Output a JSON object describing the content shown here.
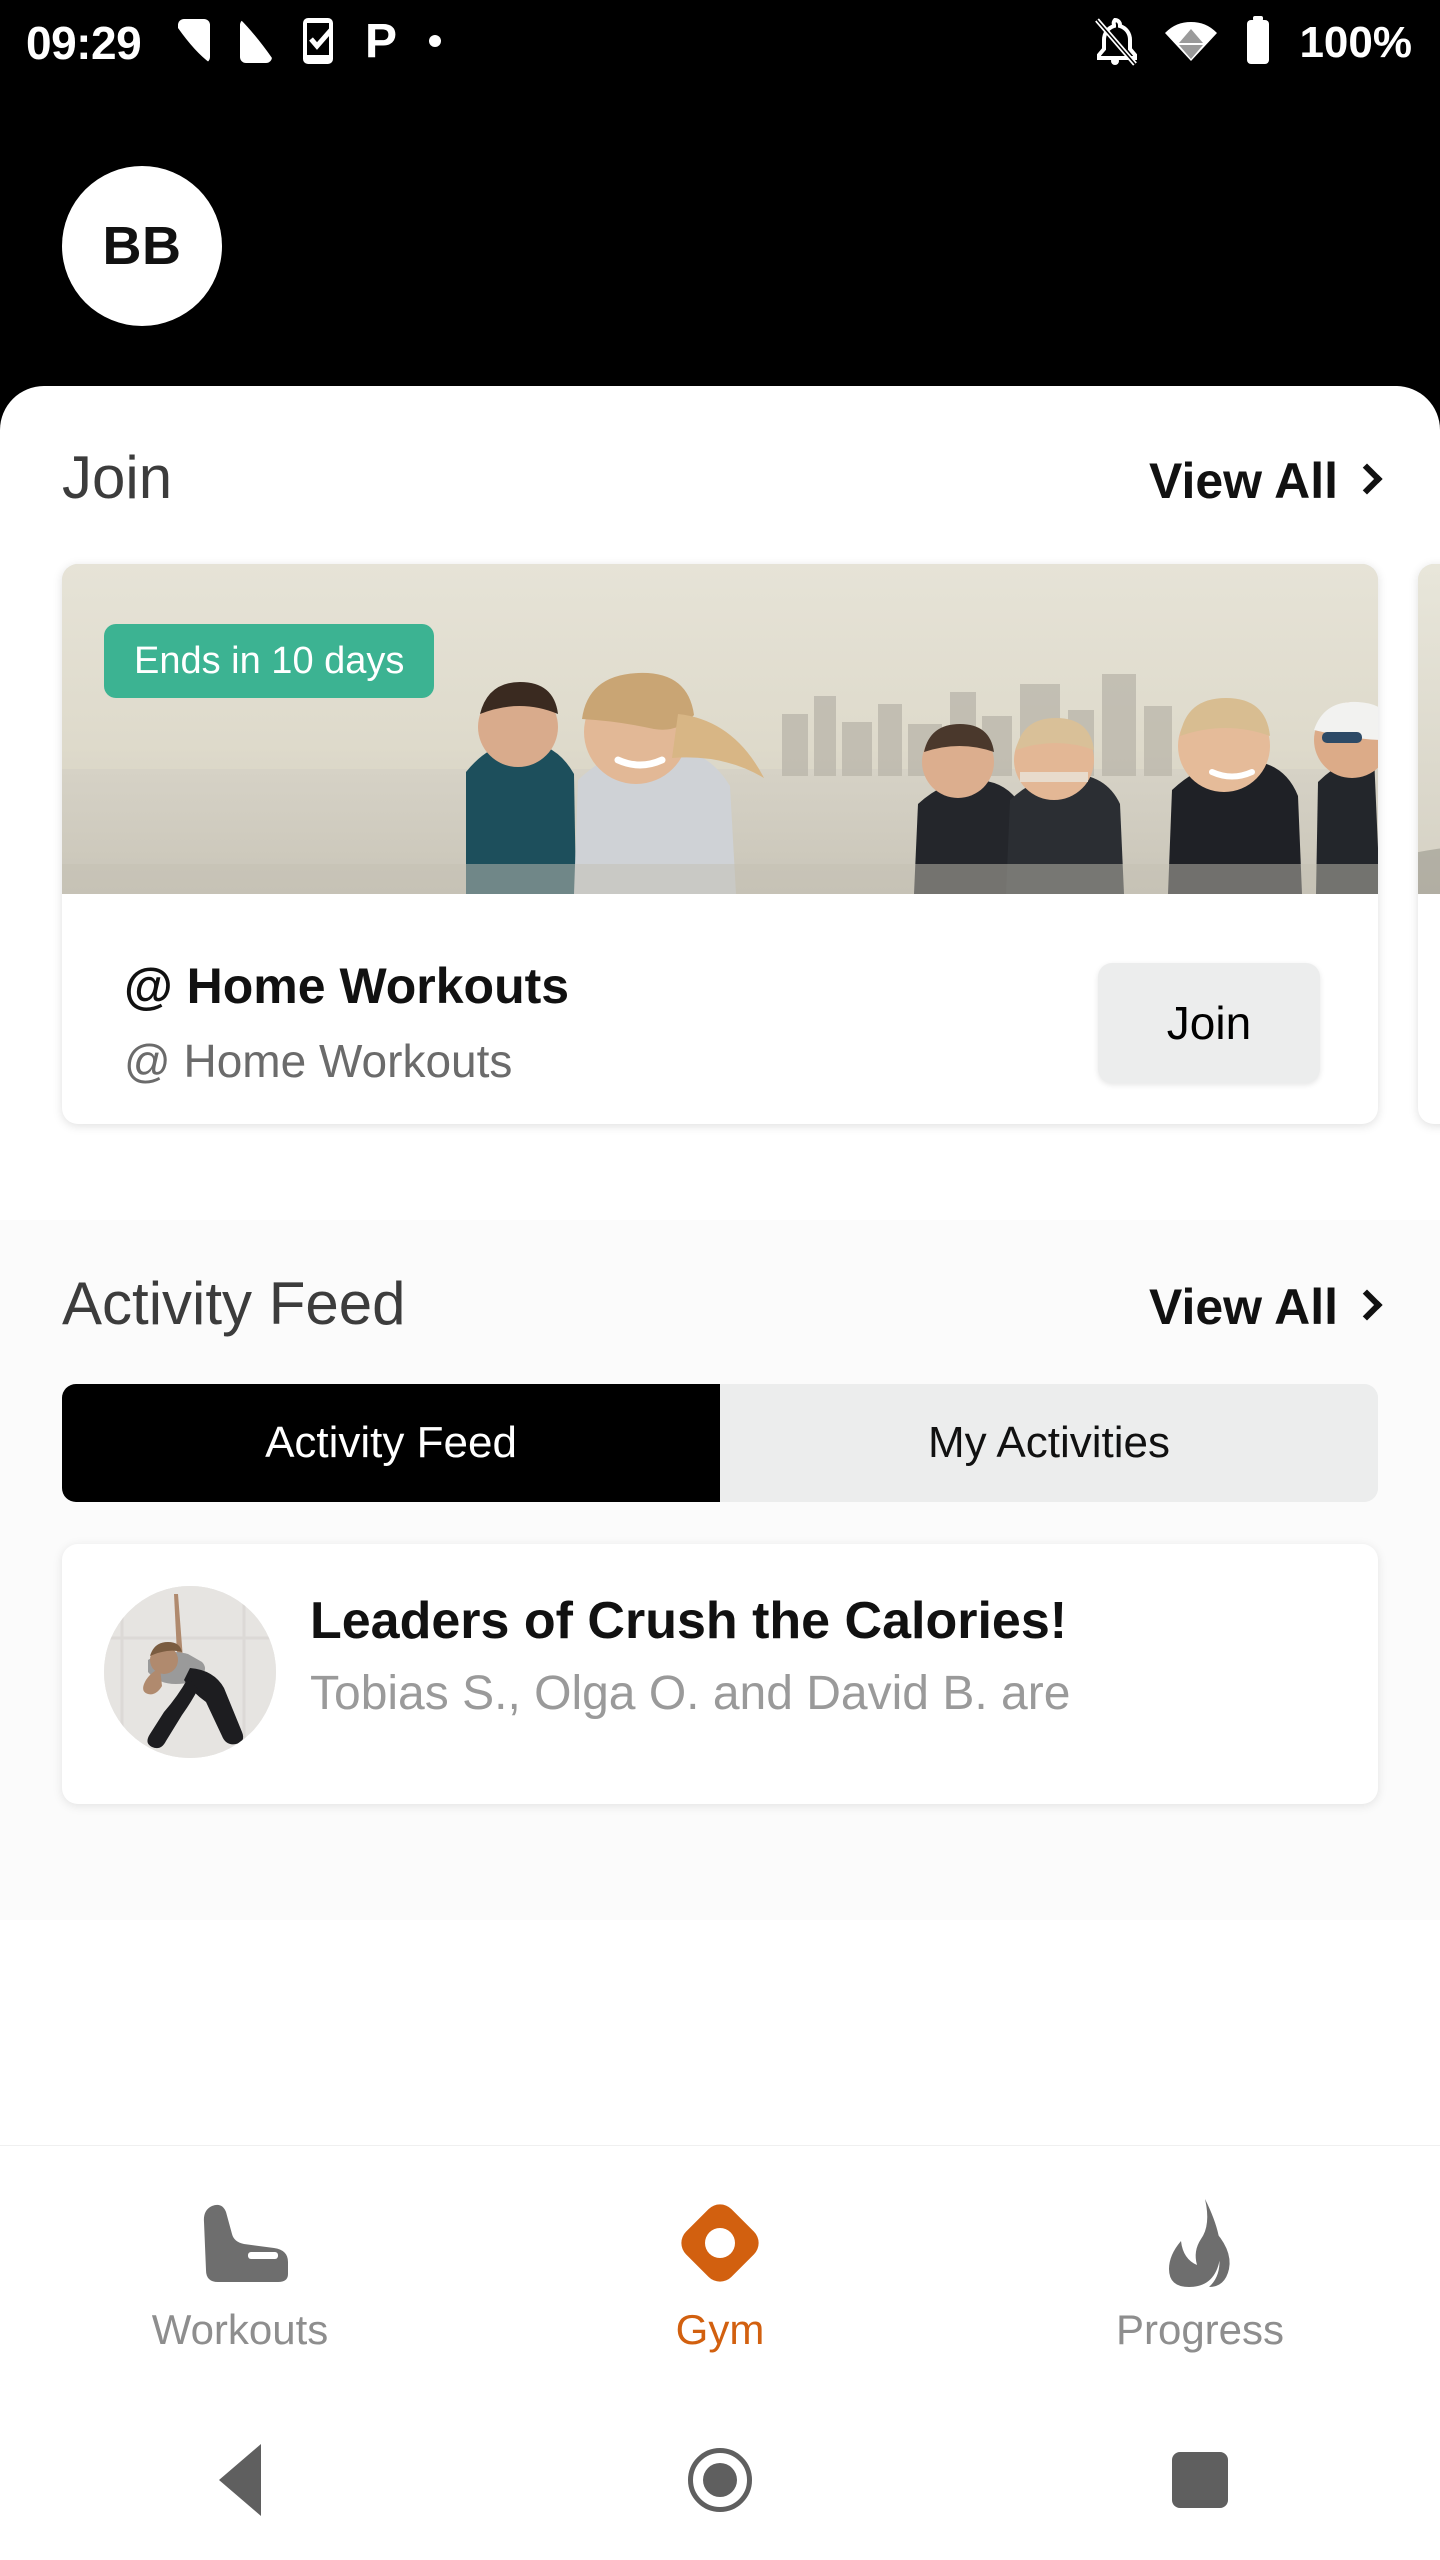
{
  "status_bar": {
    "time": "09:29",
    "battery_percent": "100%",
    "left_icons": [
      "sim-card-icon",
      "sim-card-icon",
      "tasks-checkmark-icon",
      "p-app-icon",
      "dot-icon"
    ],
    "right_icons": [
      "bell-off-icon",
      "wifi-icon",
      "battery-full-icon"
    ]
  },
  "header": {
    "avatar_initials": "BB"
  },
  "join_section": {
    "title": "Join",
    "view_all_label": "View All",
    "cards": [
      {
        "badge": "Ends in 10 days",
        "badge_color": "#3cb392",
        "title": "@ Home Workouts",
        "subtitle": "@ Home Workouts",
        "action_label": "Join",
        "hero_alt": "group-of-runners-on-waterfront"
      },
      {
        "badge": "",
        "title": "",
        "subtitle": "",
        "action_label": "",
        "hero_alt": "partially-visible-next-challenge-card"
      }
    ]
  },
  "activity_section": {
    "title": "Activity Feed",
    "view_all_label": "View All",
    "tabs": [
      {
        "label": "Activity Feed",
        "active": true
      },
      {
        "label": "My Activities",
        "active": false
      }
    ],
    "items": [
      {
        "title": "Leaders of Crush the Calories!",
        "subtitle": "Tobias S., Olga O. and David B. are",
        "thumb_alt": "woman-doing-yoga-triangle-pose"
      }
    ]
  },
  "bottom_nav": {
    "active_color": "#d2600f",
    "inactive_color": "#8e8e8e",
    "items": [
      {
        "label": "Workouts",
        "icon": "running-shoe-icon",
        "active": false
      },
      {
        "label": "Gym",
        "icon": "gym-diamond-icon",
        "active": true
      },
      {
        "label": "Progress",
        "icon": "flame-icon",
        "active": false
      }
    ]
  },
  "system_nav": {
    "items": [
      {
        "name": "back-button",
        "icon": "triangle-back-icon"
      },
      {
        "name": "home-button",
        "icon": "circle-home-icon"
      },
      {
        "name": "recents-button",
        "icon": "square-recents-icon"
      }
    ]
  }
}
